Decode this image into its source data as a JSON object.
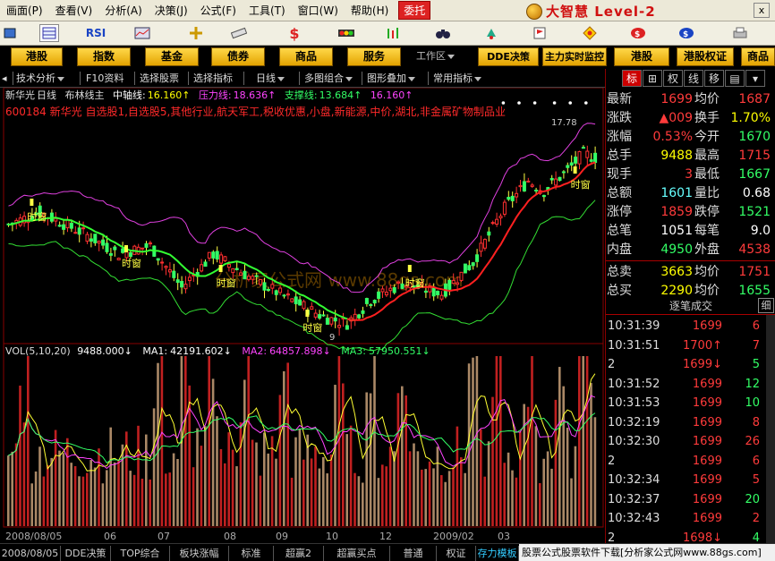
{
  "menubar": {
    "items": [
      "画面(P)",
      "查看(V)",
      "分析(A)",
      "决策(J)",
      "公式(F)",
      "工具(T)",
      "窗口(W)",
      "帮助(H)"
    ],
    "entrust": "委托",
    "brand": "大智慧 Level-2",
    "close": "x"
  },
  "toolbar": {
    "rsi": "RSI",
    "dollar": "$"
  },
  "navbar": {
    "buttons": [
      "港股",
      "指数",
      "基金",
      "债券",
      "商品",
      "服务",
      "DDE决策",
      "主力实时监控",
      "港股",
      "港股权证",
      "商品"
    ],
    "workzone": "工作区"
  },
  "subbar": {
    "items": [
      "技术分析",
      "F10资料",
      "选择股票",
      "选择指标",
      "日线",
      "多图组合",
      "图形叠加",
      "常用指标"
    ]
  },
  "chart": {
    "header_stock": "新华光",
    "header_period": "日线",
    "header_indicator": "布林线主",
    "mid_label": "中轴线:",
    "mid_value": "16.160↑",
    "upper_label": "压力线:",
    "upper_value": "18.636↑",
    "lower_label": "支撑线:",
    "lower_value": "13.684↑",
    "last_value": "16.160↑",
    "info_line": "600184 新华光 自选股1,自选股5,其他行业,航天军工,税收优惠,小盘,新能源,中价,湖北,非金属矿物制品业",
    "high_label": "17.78",
    "low_label": "9",
    "signal_label": "时窗",
    "watermark": "分析家公式网  www.88gs.com",
    "vol_header_name": "VOL(5,10,20)",
    "vol_value": "9488.000↓",
    "ma1_label": "MA1:",
    "ma1_value": "42191.602↓",
    "ma2_label": "MA2:",
    "ma2_value": "64857.898↓",
    "ma3_label": "MA3:",
    "ma3_value": "57950.551↓",
    "x_labels": [
      "2008/08/05",
      "06",
      "07",
      "08",
      "09",
      "10",
      "12",
      "2009/02",
      "03"
    ]
  },
  "quote": {
    "rows": [
      {
        "l1": "最新",
        "v1": "1699",
        "c1": "red",
        "l2": "均价",
        "v2": "1687",
        "c2": "red"
      },
      {
        "l1": "涨跌",
        "v1": "▲009",
        "c1": "red",
        "l2": "换手",
        "v2": "1.70%",
        "c2": "yellow"
      },
      {
        "l1": "涨幅",
        "v1": "0.53%",
        "c1": "red",
        "l2": "今开",
        "v2": "1670",
        "c2": "green"
      },
      {
        "l1": "总手",
        "v1": "9488",
        "c1": "yellow",
        "l2": "最高",
        "v2": "1715",
        "c2": "red"
      },
      {
        "l1": "现手",
        "v1": "3",
        "c1": "red",
        "l2": "最低",
        "v2": "1667",
        "c2": "green"
      },
      {
        "l1": "总额",
        "v1": "1601",
        "c1": "cyan",
        "l2": "量比",
        "v2": "0.68",
        "c2": "white"
      },
      {
        "l1": "涨停",
        "v1": "1859",
        "c1": "red",
        "l2": "跌停",
        "v2": "1521",
        "c2": "green"
      },
      {
        "l1": "总笔",
        "v1": "1051",
        "c1": "white",
        "l2": "每笔",
        "v2": "9.0",
        "c2": "white"
      },
      {
        "l1": "内盘",
        "v1": "4950",
        "c1": "green",
        "l2": "外盘",
        "v2": "4538",
        "c2": "red"
      },
      {
        "l1": "总卖",
        "v1": "3663",
        "c1": "yellow",
        "l2": "均价",
        "v2": "1751",
        "c2": "red"
      },
      {
        "l1": "总买",
        "v1": "2290",
        "c1": "yellow",
        "l2": "均价",
        "v2": "1655",
        "c2": "green"
      }
    ],
    "tabs": [
      "标",
      "⊞",
      "权",
      "线",
      "移",
      "▤",
      "▾"
    ]
  },
  "ticks": {
    "header": "逐笔成交",
    "detail": "细",
    "rows": [
      {
        "time": "10:31:39",
        "price": "1699",
        "pcolor": "red",
        "vol": "6",
        "vcolor": "red"
      },
      {
        "time": "10:31:51",
        "price": "1700↑",
        "pcolor": "red",
        "vol": "7",
        "vcolor": "red"
      },
      {
        "time": "2",
        "price": "1699↓",
        "pcolor": "red",
        "vol": "5",
        "vcolor": "green"
      },
      {
        "time": "10:31:52",
        "price": "1699",
        "pcolor": "red",
        "vol": "12",
        "vcolor": "green"
      },
      {
        "time": "10:31:53",
        "price": "1699",
        "pcolor": "red",
        "vol": "10",
        "vcolor": "green"
      },
      {
        "time": "10:32:19",
        "price": "1699",
        "pcolor": "red",
        "vol": "8",
        "vcolor": "red"
      },
      {
        "time": "10:32:30",
        "price": "1699",
        "pcolor": "red",
        "vol": "26",
        "vcolor": "red"
      },
      {
        "time": "2",
        "price": "1699",
        "pcolor": "red",
        "vol": "6",
        "vcolor": "red"
      },
      {
        "time": "10:32:34",
        "price": "1699",
        "pcolor": "red",
        "vol": "5",
        "vcolor": "red"
      },
      {
        "time": "10:32:37",
        "price": "1699",
        "pcolor": "red",
        "vol": "20",
        "vcolor": "green"
      },
      {
        "time": "10:32:43",
        "price": "1699",
        "pcolor": "red",
        "vol": "2",
        "vcolor": "red"
      },
      {
        "time": "2",
        "price": "1698↓",
        "pcolor": "red",
        "vol": "4",
        "vcolor": "green"
      }
    ]
  },
  "bottom": {
    "tabs": [
      "2008/08/05",
      "DDE决策",
      "TOP综合",
      "板块涨幅",
      "标准",
      "超赢2",
      "超赢买点",
      "普通",
      "权证",
      "存力模板"
    ],
    "ad": "股票公式股票软件下载[分析家公式网www.88gs.com]"
  }
}
